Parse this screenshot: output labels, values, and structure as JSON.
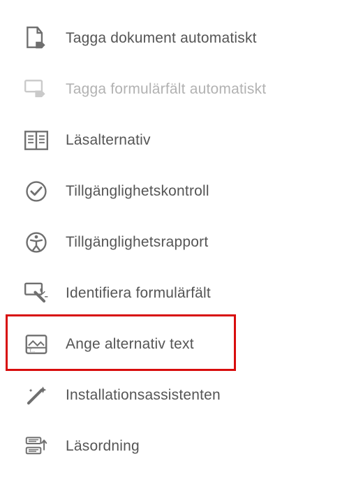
{
  "menu": {
    "items": [
      {
        "label": "Tagga dokument automatiskt"
      },
      {
        "label": "Tagga formulärfält automatiskt"
      },
      {
        "label": "Läsalternativ"
      },
      {
        "label": "Tillgänglighetskontroll"
      },
      {
        "label": "Tillgänglighetsrapport"
      },
      {
        "label": "Identifiera formulärfält"
      },
      {
        "label": "Ange alternativ text"
      },
      {
        "label": "Installationsassistenten"
      },
      {
        "label": "Läsordning"
      }
    ]
  },
  "highlight_index": 6
}
